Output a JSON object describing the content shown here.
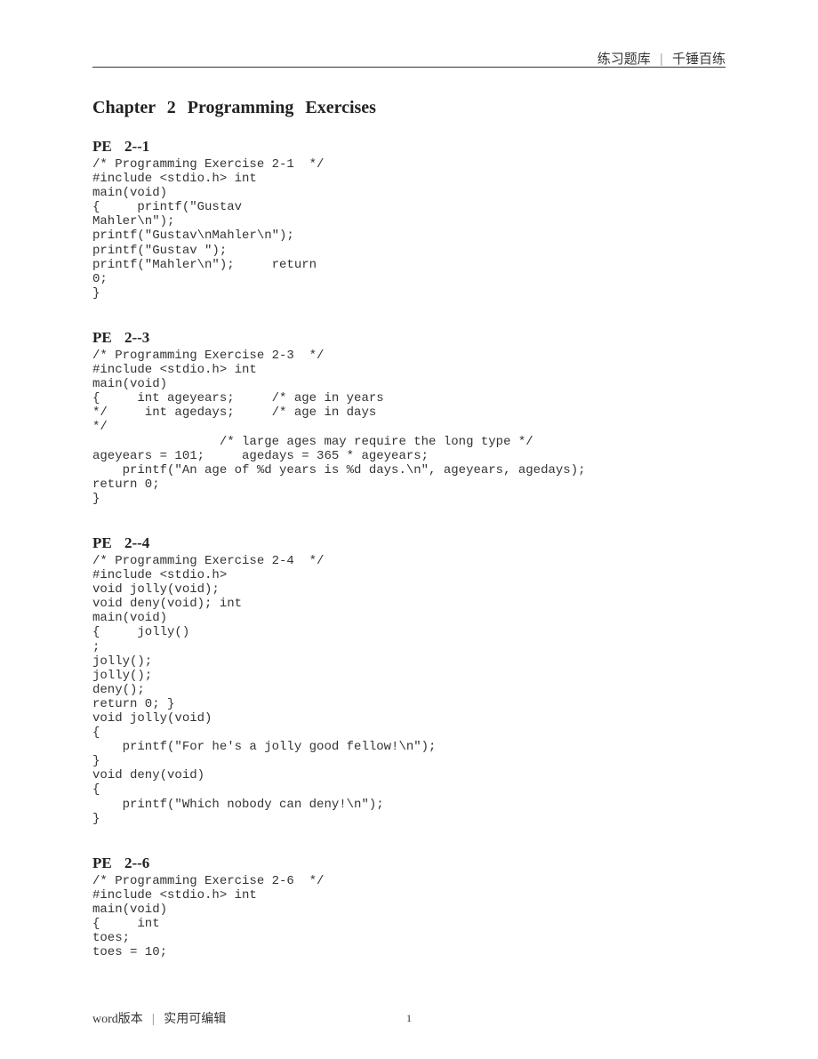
{
  "header": {
    "left": "练习题库",
    "divider": "|",
    "right": "千锤百练"
  },
  "chapter_title": "Chapter  2  Programming  Exercises",
  "sections": [
    {
      "title": "PE  2-‐1",
      "code": "/* Programming Exercise 2-1  */\n#include <stdio.h> int\nmain(void)\n{     printf(\"Gustav\nMahler\\n\");\nprintf(\"Gustav\\nMahler\\n\");\nprintf(\"Gustav \");\nprintf(\"Mahler\\n\");     return\n0;\n}"
    },
    {
      "title": "PE  2-‐3",
      "code": "/* Programming Exercise 2-3  */\n#include <stdio.h> int\nmain(void)\n{     int ageyears;     /* age in years\n*/     int agedays;     /* age in days\n*/\n                 /* large ages may require the long type */\nageyears = 101;     agedays = 365 * ageyears;\n    printf(\"An age of %d years is %d days.\\n\", ageyears, agedays);\nreturn 0;\n}"
    },
    {
      "title": "PE  2-‐4",
      "code": "/* Programming Exercise 2-4  */\n#include <stdio.h>\nvoid jolly(void);\nvoid deny(void); int\nmain(void)\n{     jolly()\n;\njolly();\njolly();\ndeny();\nreturn 0; }\nvoid jolly(void)\n{\n    printf(\"For he's a jolly good fellow!\\n\");\n}\nvoid deny(void)\n{\n    printf(\"Which nobody can deny!\\n\");\n}"
    },
    {
      "title": "PE  2-‐6",
      "code": "/* Programming Exercise 2-6  */\n#include <stdio.h> int\nmain(void)\n{     int\ntoes;\ntoes = 10;"
    }
  ],
  "footer": {
    "word": "word",
    "version": "版本",
    "divider": "|",
    "editable": "实用可编辑"
  },
  "page_number": "1"
}
